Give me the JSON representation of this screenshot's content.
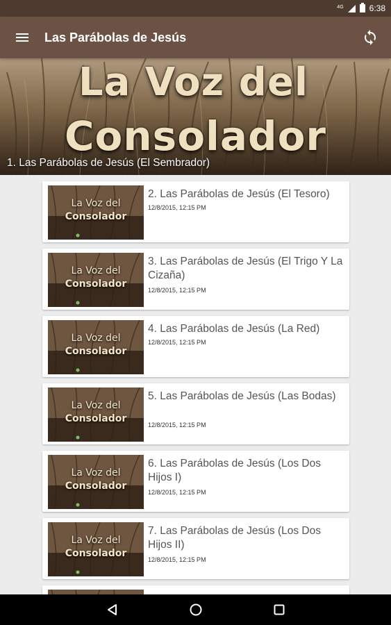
{
  "status_bar": {
    "network": "4G",
    "time": "6:38"
  },
  "toolbar": {
    "title": "Las Parábolas de Jesús"
  },
  "hero": {
    "title_line1": "La Voz del",
    "title_line2": "Consolador",
    "caption": "1. Las Parábolas de Jesús (El Sembrador)"
  },
  "thumbnail": {
    "line1": "La Voz del",
    "line2": "Consolador"
  },
  "items": [
    {
      "title": "2. Las Parábolas de Jesús (El Tesoro)",
      "date": "12/8/2015, 12:15 PM"
    },
    {
      "title": "3. Las Parábolas de Jesús (El Trigo Y La Cizaña)",
      "date": "12/8/2015, 12:15 PM"
    },
    {
      "title": "4. Las Parábolas de Jesús  (La Red)",
      "date": "12/8/2015, 12:15 PM"
    },
    {
      "title": "5. Las Parábolas de Jesús (Las Bodas)",
      "date": "12/8/2015, 12:15 PM"
    },
    {
      "title": "6.  Las Parábolas de Jesús (Los Dos Hijos I)",
      "date": "12/8/2015, 12:15 PM"
    },
    {
      "title": "7. Las Parábolas de Jesús (Los Dos Hijos II)",
      "date": "12/8/2015, 12:15 PM"
    }
  ],
  "icons": {
    "menu": "hamburger-menu-icon",
    "refresh": "refresh-icon",
    "back": "back-icon",
    "home": "home-icon",
    "recents": "recents-icon"
  },
  "colors": {
    "status_bar": "#4e3b30",
    "toolbar": "#6b5245",
    "background": "#ececec"
  }
}
